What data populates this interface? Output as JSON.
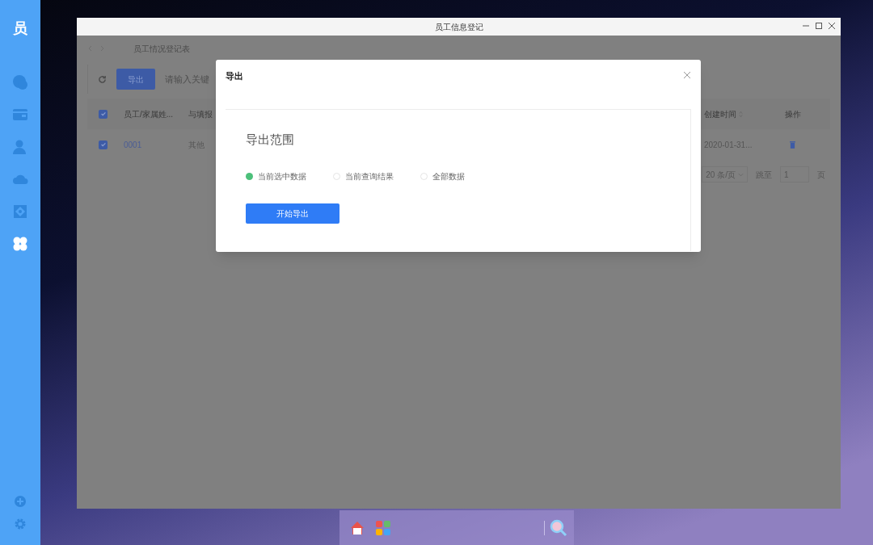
{
  "sidebar": {
    "logo": "员",
    "items": [
      {
        "selected": false
      },
      {
        "selected": false
      },
      {
        "selected": false
      },
      {
        "selected": false
      },
      {
        "selected": false
      },
      {
        "selected": true
      }
    ]
  },
  "window": {
    "title": "员工信息登记"
  },
  "page": {
    "breadcrumb": "员工情况登记表",
    "export_button": "导出",
    "search": {
      "placeholder": "请输入关键"
    },
    "table": {
      "columns": [
        {
          "label": "员工/家属姓...",
          "sortable": false
        },
        {
          "label": "与填报"
        },
        {
          "label": "创建时间",
          "sortable": true
        },
        {
          "label": "操作",
          "sortable": false
        }
      ],
      "header_checked": true,
      "rows": [
        {
          "checked": true,
          "cells": [
            "0001",
            "其他",
            "2020-01-31..."
          ]
        }
      ]
    },
    "pagination": {
      "page_size": "20 条/页",
      "jump_label": "跳至",
      "page_value": "1",
      "page_unit": "页"
    }
  },
  "dialog": {
    "title": "导出",
    "section_title": "导出范围",
    "options": [
      {
        "label": "当前选中数据",
        "selected": true
      },
      {
        "label": "当前查询结果",
        "selected": false
      },
      {
        "label": "全部数据",
        "selected": false
      }
    ],
    "start_button": "开始导出"
  }
}
